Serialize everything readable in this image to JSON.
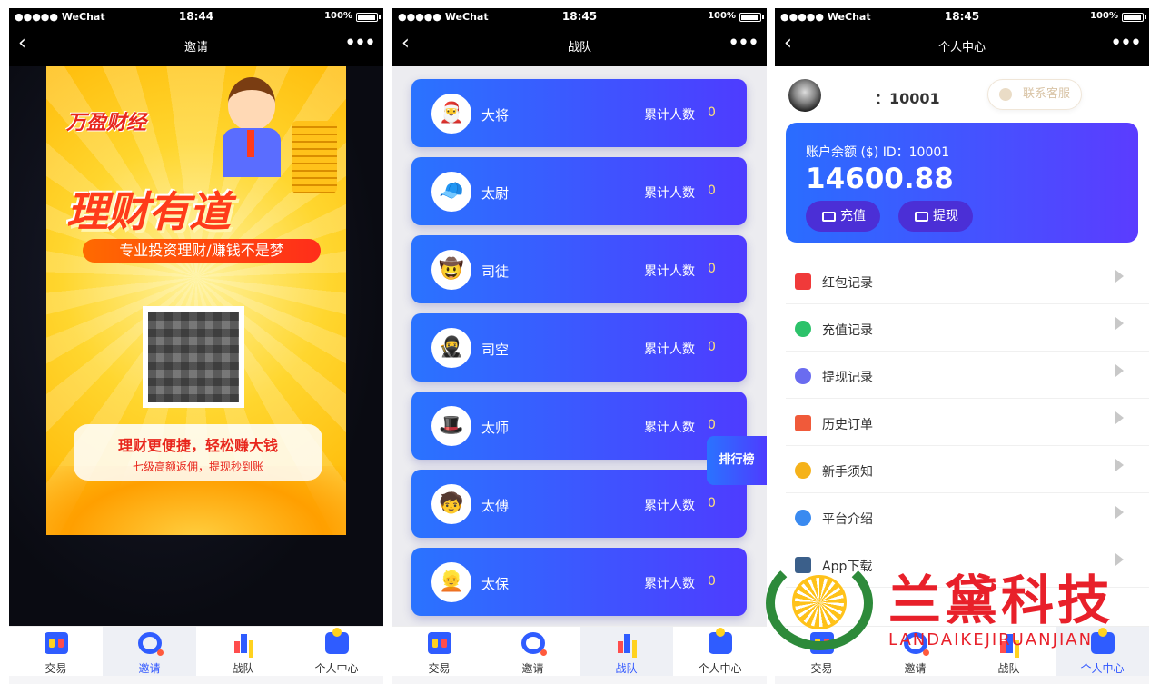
{
  "status": {
    "carrier": "●●●●● WeChat",
    "battery_pct": "100%"
  },
  "screens": [
    {
      "time": "18:44",
      "title": "邀请"
    },
    {
      "time": "18:45",
      "title": "战队"
    },
    {
      "time": "18:45",
      "title": "个人中心"
    }
  ],
  "tabs": [
    {
      "label": "交易",
      "icon": "trade-icon"
    },
    {
      "label": "邀请",
      "icon": "invite-icon"
    },
    {
      "label": "战队",
      "icon": "team-icon"
    },
    {
      "label": "个人中心",
      "icon": "user-icon"
    }
  ],
  "invite": {
    "brand": "万盈财经",
    "headline": "理财有道",
    "slogan": "专业投资理财/赚钱不是梦",
    "promo_line1": "理财更便捷，轻松赚大钱",
    "promo_line2": "七级高额返佣，提现秒到账"
  },
  "team": {
    "count_label": "累计人数",
    "rank_button": "排行榜",
    "ranks": [
      {
        "name": "大将",
        "count": "0",
        "icon": "general-avatar-icon"
      },
      {
        "name": "太尉",
        "count": "0",
        "icon": "marshal-avatar-icon"
      },
      {
        "name": "司徒",
        "count": "0",
        "icon": "minister-avatar-icon"
      },
      {
        "name": "司空",
        "count": "0",
        "icon": "official-avatar-icon"
      },
      {
        "name": "太师",
        "count": "0",
        "icon": "grand-tutor-avatar-icon"
      },
      {
        "name": "太傅",
        "count": "0",
        "icon": "tutor-avatar-icon"
      },
      {
        "name": "太保",
        "count": "0",
        "icon": "guardian-avatar-icon"
      }
    ]
  },
  "profile": {
    "user_id": "：10001",
    "support_button": "联系客服",
    "balance_label": "账户余额 ($) ID：10001",
    "balance": "14600.88",
    "recharge_button": "充值",
    "withdraw_button": "提现",
    "menu": [
      {
        "label": "红包记录",
        "icon": "red-envelope-icon",
        "color": "#f03a3a"
      },
      {
        "label": "充值记录",
        "icon": "recharge-icon",
        "color": "#2cc26a"
      },
      {
        "label": "提现记录",
        "icon": "withdraw-icon",
        "color": "#6a6cf0"
      },
      {
        "label": "历史订单",
        "icon": "order-icon",
        "color": "#f05a3a"
      },
      {
        "label": "新手须知",
        "icon": "info-icon",
        "color": "#f5b21a"
      },
      {
        "label": "平台介绍",
        "icon": "list-icon",
        "color": "#3a8af0"
      },
      {
        "label": "App下载",
        "icon": "download-icon",
        "color": "#3b5f8a"
      }
    ]
  },
  "watermark": {
    "title": "兰黛科技",
    "subtitle": "LANDAIKEJIRUANJIAN"
  }
}
